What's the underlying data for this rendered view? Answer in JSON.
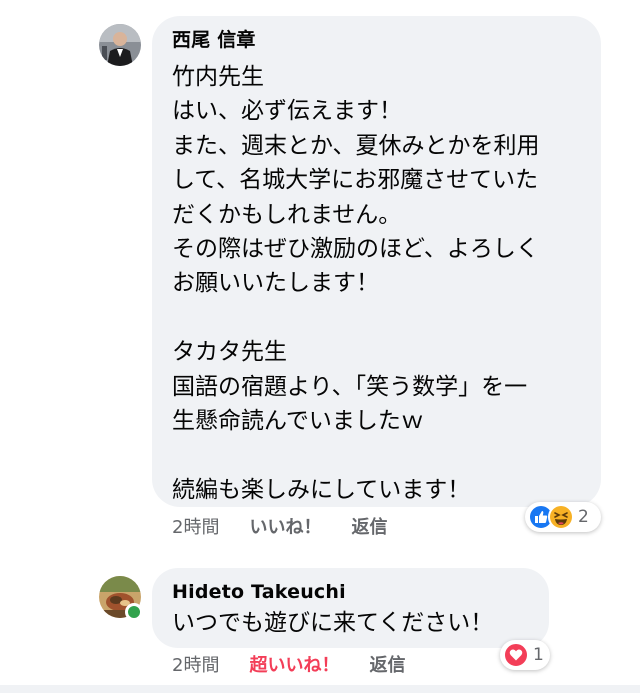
{
  "comments": [
    {
      "author": "西尾 信章",
      "lines": [
        "竹内先生",
        "はい、必ず伝えます！",
        "また、週末とか、夏休みとかを利用",
        "して、名城大学にお邪魔させていた",
        "だくかもしれません。",
        "その際はぜひ激励のほど、よろしく",
        "お願いいたします！",
        "",
        "タカタ先生",
        "国語の宿題より、「笑う数学」を一",
        "生懸命読んでいましたｗ",
        "",
        "続編も楽しみにしています！"
      ],
      "time": "2時間",
      "like_label": "いいね！",
      "reply_label": "返信",
      "reactions": {
        "icons": [
          "like-icon",
          "haha-icon"
        ],
        "count": "2"
      }
    },
    {
      "author": "Hideto Takeuchi",
      "lines": [
        "いつでも遊びに来てください！"
      ],
      "time": "2時間",
      "like_label": "超いいね！",
      "reply_label": "返信",
      "reactions": {
        "icons": [
          "love-icon"
        ],
        "count": "1"
      }
    }
  ],
  "colors": {
    "bubble": "#f0f2f5",
    "like_blue": "#1877f2",
    "love_red": "#f33e58",
    "haha_yellow": "#f7b125",
    "online_green": "#31a24c"
  }
}
